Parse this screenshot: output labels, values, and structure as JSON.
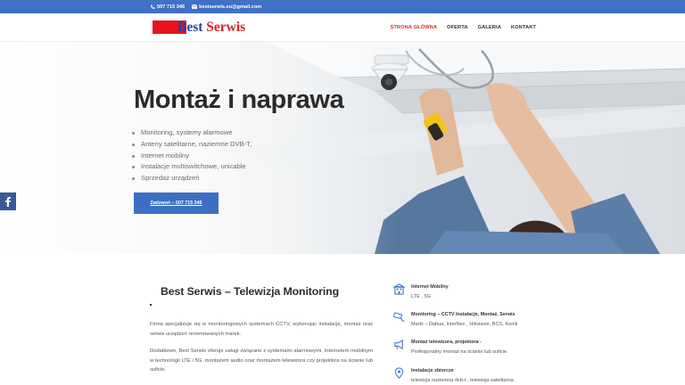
{
  "topbar": {
    "phone": "507 715 346",
    "email": "bestserwis.eu@gmail.com"
  },
  "logo": {
    "word1": "Best",
    "word2": "Serwis"
  },
  "nav": {
    "items": [
      {
        "label": "STRONA GŁÓWNA",
        "active": true
      },
      {
        "label": "OFERTA",
        "active": false
      },
      {
        "label": "GALERIA",
        "active": false
      },
      {
        "label": "KONTAKT",
        "active": false
      }
    ]
  },
  "hero": {
    "title": "Montaż i naprawa",
    "list": [
      "Monitoring, systemy alarmowe",
      "Anteny satelitarne, naziemne DVB-T,",
      "Internet mobilny",
      "Instalacje multiswitchowe, unicable",
      "Sprzedaż urządzeń"
    ],
    "button": "Zadzwoń – 507 715 346"
  },
  "social": {
    "icon": "facebook-icon"
  },
  "content": {
    "title": "Best Serwis – Telewizja Monitoring",
    "para1": "Firma specjalizuje się w monitoringowych systemach CCTV, wykonując instalację, montaż oraz serwis urządzeń renomowanych marek.",
    "para2": "Dodatkowo, Best Serwis oferuje usługi związane z systemami alarmowymi, Internetem mobilnym w technologii LTE i 5G, montażem audio oraz montażem telewizora czy projektora na ścianie lub suficie."
  },
  "features": [
    {
      "icon": "building-icon",
      "title": "Internet Mobilny",
      "desc": "LTE , 5G"
    },
    {
      "icon": "cctv-camera-icon",
      "title": "Monitoring – CCTV Instalacje, Montaż, Serwis",
      "desc": "Marki – Dahua, InterNec , Hikvision, BCS, Kenik"
    },
    {
      "icon": "megaphone-icon",
      "title": "Montaż telewizora, projektora -",
      "desc": "Profesjonalny montaż na ścianie lub suficie."
    },
    {
      "icon": "pin-icon",
      "title": "Instalacje zbiorcze",
      "desc": "telewizja naziemna dvb-t , telewizja satelitarna"
    }
  ],
  "colors": {
    "topbar": "#3f71c4",
    "nav_active": "#e02b20",
    "button": "#3c6fc4",
    "facebook": "#3b5998",
    "logo_blue": "#2b3f9c",
    "logo_red": "#d3232a"
  }
}
